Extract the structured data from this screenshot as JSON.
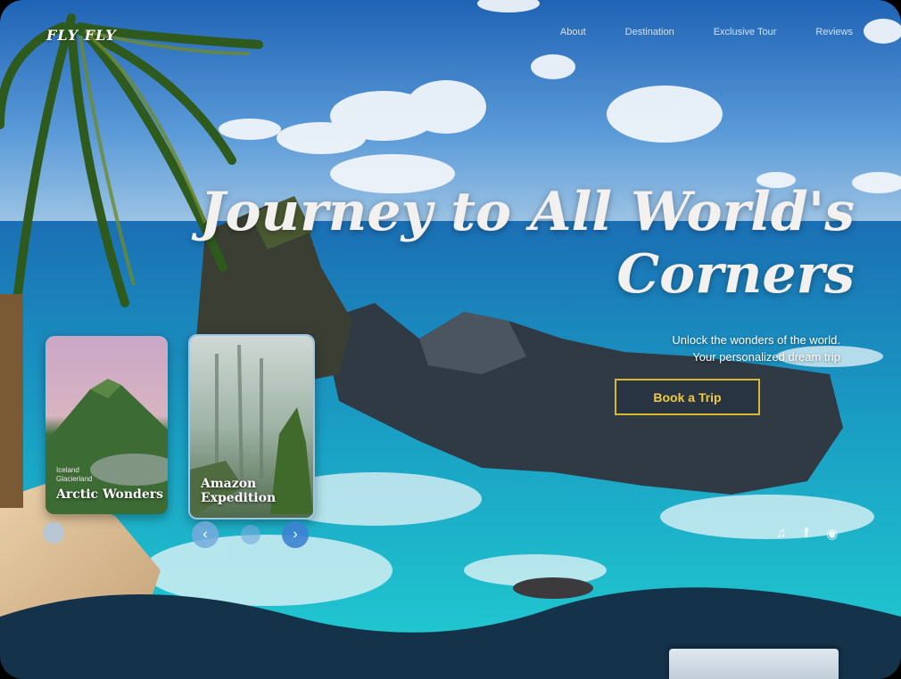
{
  "brand": {
    "logo_text": "FLY FLY"
  },
  "nav": {
    "items": [
      "About",
      "Destination",
      "Exclusive Tour",
      "Reviews"
    ]
  },
  "hero": {
    "headline_line1": "Journey to All World's",
    "headline_line2": "Corners",
    "subtitle_line1": "Unlock the wonders of the world.",
    "subtitle_line2": "Your personalized dream trip",
    "cta_label": "Book a Trip"
  },
  "cards": [
    {
      "small": "Iceland",
      "small2": "Glacierland",
      "title": "Arctic Wonders"
    },
    {
      "title": "Amazon Expedition"
    }
  ],
  "carousel": {
    "prev_icon": "chevron-left-icon",
    "next_icon": "chevron-right-icon"
  },
  "social": [
    "tiktok-icon",
    "facebook-icon",
    "instagram-icon"
  ],
  "colors": {
    "accent": "#d9b830",
    "footer": "#14324a"
  }
}
